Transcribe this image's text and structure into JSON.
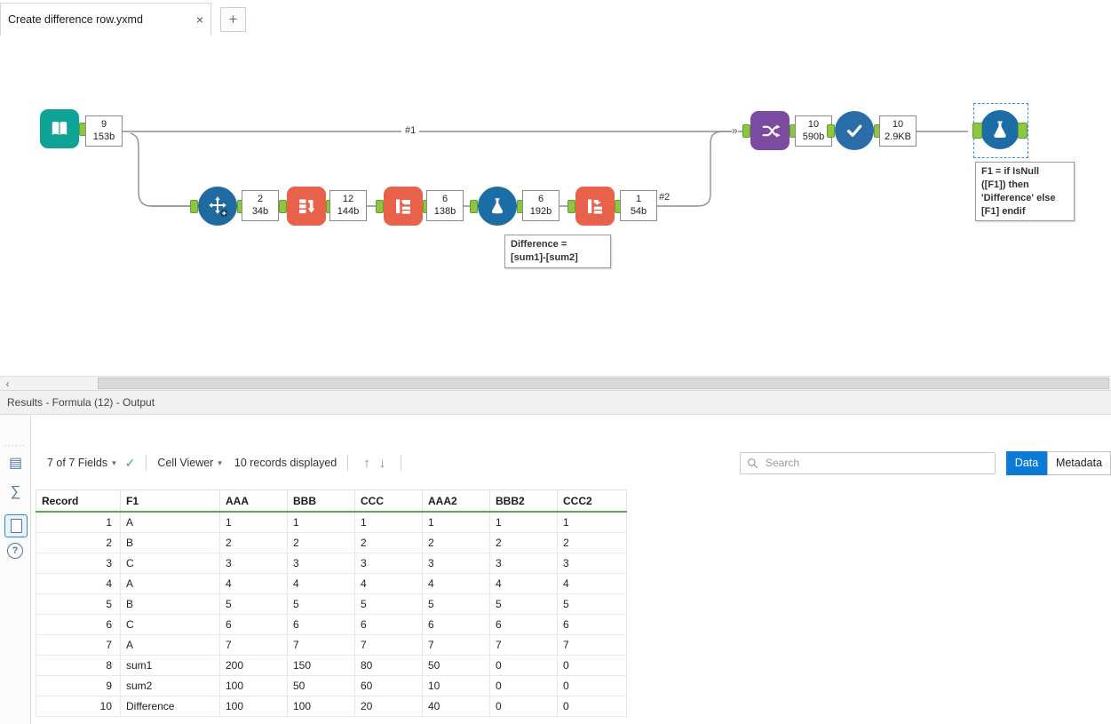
{
  "tab_bar": {
    "tab_title": "Create difference row.yxmd",
    "close_icon": "×",
    "new_tab_icon": "+"
  },
  "canvas": {
    "labels": {
      "conn1": "#1",
      "conn2": "#2",
      "merge": "»"
    },
    "badges": {
      "input": {
        "count": "9",
        "size": "153b"
      },
      "arrange": {
        "count": "2",
        "size": "34b"
      },
      "crosstab1": {
        "count": "12",
        "size": "144b"
      },
      "transpose": {
        "count": "6",
        "size": "138b"
      },
      "formula1": {
        "count": "6",
        "size": "192b"
      },
      "crosstab2": {
        "count": "1",
        "size": "54b"
      },
      "union": {
        "count": "10",
        "size": "590b"
      },
      "check": {
        "count": "10",
        "size": "2.9KB"
      }
    },
    "annotations": {
      "formula1": "Difference =\n[sum1]-[sum2]",
      "formula2": "F1 = if IsNull\n([F1]) then\n'Difference' else\n[F1] endif"
    }
  },
  "scrollbar": {
    "left_arrow": "‹"
  },
  "results": {
    "panel_title": "Results - Formula (12) - Output",
    "sidebar_icons": {
      "grip": "······",
      "grid": "▤",
      "sigma": "∑",
      "help": "?"
    },
    "toolbar": {
      "fields_selector": "7 of 7 Fields",
      "caret": "▾",
      "check_icon": "✓",
      "cell_viewer": "Cell Viewer",
      "records_displayed": "10 records displayed",
      "up_arrow": "↑",
      "down_arrow": "↓",
      "search_placeholder": "Search",
      "data_tab": "Data",
      "metadata_tab": "Metadata"
    },
    "table": {
      "columns": [
        "Record",
        "F1",
        "AAA",
        "BBB",
        "CCC",
        "AAA2",
        "BBB2",
        "CCC2"
      ],
      "rows": [
        [
          "1",
          "A",
          "1",
          "1",
          "1",
          "1",
          "1",
          "1"
        ],
        [
          "2",
          "B",
          "2",
          "2",
          "2",
          "2",
          "2",
          "2"
        ],
        [
          "3",
          "C",
          "3",
          "3",
          "3",
          "3",
          "3",
          "3"
        ],
        [
          "4",
          "A",
          "4",
          "4",
          "4",
          "4",
          "4",
          "4"
        ],
        [
          "5",
          "B",
          "5",
          "5",
          "5",
          "5",
          "5",
          "5"
        ],
        [
          "6",
          "C",
          "6",
          "6",
          "6",
          "6",
          "6",
          "6"
        ],
        [
          "7",
          "A",
          "7",
          "7",
          "7",
          "7",
          "7",
          "7"
        ],
        [
          "8",
          "sum1",
          "200",
          "150",
          "80",
          "50",
          "0",
          "0"
        ],
        [
          "9",
          "sum2",
          "100",
          "50",
          "60",
          "10",
          "0",
          "0"
        ],
        [
          "10",
          "Difference",
          "100",
          "100",
          "20",
          "40",
          "0",
          "0"
        ]
      ]
    }
  }
}
